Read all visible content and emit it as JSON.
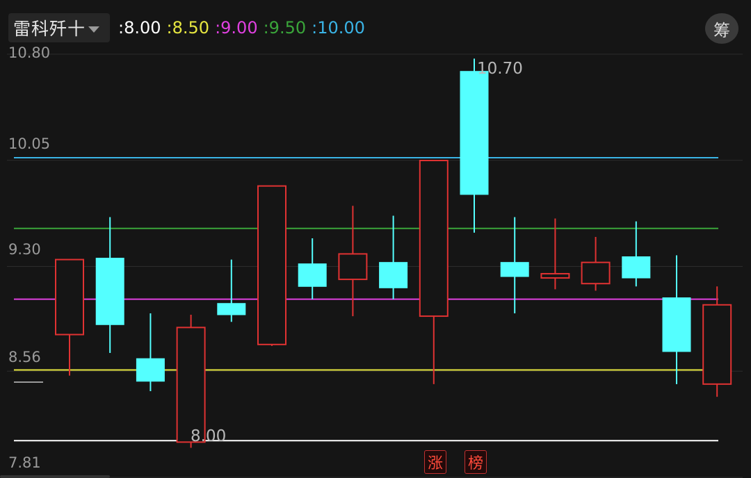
{
  "header": {
    "indicator_name": "雷科歼十",
    "levels": [
      {
        "label": ":8.00",
        "color": "#ffffff"
      },
      {
        "label": ":8.50",
        "color": "#e6e640"
      },
      {
        "label": ":9.00",
        "color": "#e040e0"
      },
      {
        "label": ":9.50",
        "color": "#3aa53a"
      },
      {
        "label": ":10.00",
        "color": "#3ab4e6"
      }
    ],
    "chip_label": "筹"
  },
  "chart_data": {
    "type": "candlestick",
    "y_ticks": [
      "10.80",
      "10.05",
      "9.30",
      "8.56",
      "7.81"
    ],
    "ylim": [
      7.81,
      10.8
    ],
    "horizontal_levels": [
      {
        "value": 8.0,
        "color": "#ffffff"
      },
      {
        "value": 8.5,
        "color": "#e6e640"
      },
      {
        "value": 9.0,
        "color": "#e040e0"
      },
      {
        "value": 9.5,
        "color": "#3aa53a"
      },
      {
        "value": 10.0,
        "color": "#3ab4e6"
      }
    ],
    "candles": [
      {
        "open": 8.75,
        "close": 9.28,
        "high": 9.28,
        "low": 8.46,
        "direction": "up"
      },
      {
        "open": 9.29,
        "close": 8.82,
        "high": 9.58,
        "low": 8.62,
        "direction": "down"
      },
      {
        "open": 8.58,
        "close": 8.42,
        "high": 8.9,
        "low": 8.35,
        "direction": "down"
      },
      {
        "open": 7.99,
        "close": 8.8,
        "high": 8.89,
        "low": 7.95,
        "direction": "up"
      },
      {
        "open": 8.97,
        "close": 8.89,
        "high": 9.28,
        "low": 8.84,
        "direction": "down"
      },
      {
        "open": 8.68,
        "close": 9.8,
        "high": 9.8,
        "low": 8.67,
        "direction": "up"
      },
      {
        "open": 9.25,
        "close": 9.09,
        "high": 9.43,
        "low": 9.0,
        "direction": "down"
      },
      {
        "open": 9.14,
        "close": 9.32,
        "high": 9.66,
        "low": 8.88,
        "direction": "up"
      },
      {
        "open": 9.26,
        "close": 9.08,
        "high": 9.59,
        "low": 9.0,
        "direction": "down"
      },
      {
        "open": 8.88,
        "close": 9.98,
        "high": 9.98,
        "low": 8.4,
        "direction": "up"
      },
      {
        "open": 10.61,
        "close": 9.74,
        "high": 10.7,
        "low": 9.47,
        "direction": "down"
      },
      {
        "open": 9.26,
        "close": 9.16,
        "high": 9.58,
        "low": 8.9,
        "direction": "down"
      },
      {
        "open": 9.15,
        "close": 9.18,
        "high": 9.57,
        "low": 9.07,
        "direction": "up"
      },
      {
        "open": 9.11,
        "close": 9.26,
        "high": 9.44,
        "low": 9.06,
        "direction": "up"
      },
      {
        "open": 9.3,
        "close": 9.15,
        "high": 9.55,
        "low": 9.09,
        "direction": "down"
      },
      {
        "open": 9.01,
        "close": 8.63,
        "high": 9.31,
        "low": 8.4,
        "direction": "down"
      },
      {
        "open": 8.4,
        "close": 8.96,
        "high": 9.09,
        "low": 8.31,
        "direction": "up"
      }
    ],
    "annotations": [
      {
        "text": "10.70",
        "value": 10.7
      },
      {
        "text": "8.00",
        "value": 8.0
      }
    ],
    "up_color": "#e03232",
    "down_color": "#54ffff"
  },
  "badges": [
    "涨",
    "榜"
  ]
}
